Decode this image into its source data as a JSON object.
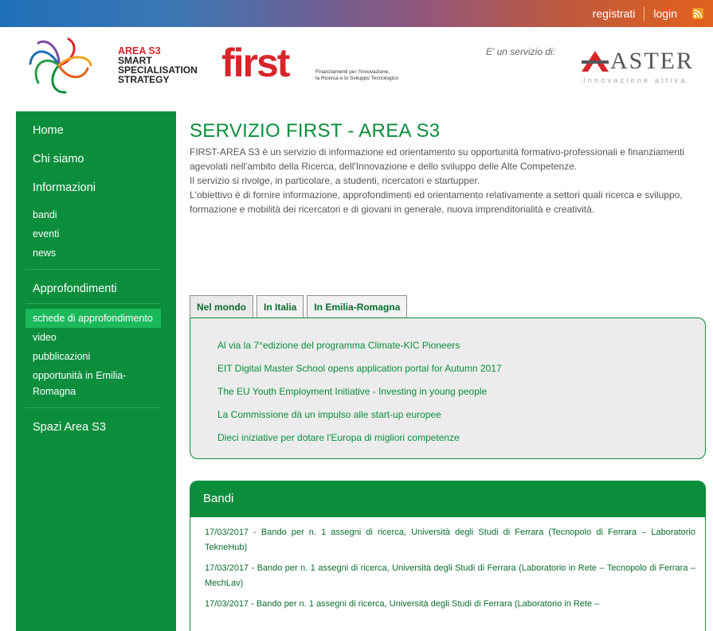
{
  "topbar": {
    "register": "registrati",
    "login": "login",
    "rss_icon": "rss-icon"
  },
  "header": {
    "area_logo": {
      "line1": "AREA S3",
      "line2": "SMART",
      "line3": "SPECIALISATION",
      "line4": "STRATEGY"
    },
    "first_logo": {
      "word": "first",
      "sub1": "Finanziamenti per l'Innovazione,",
      "sub2": "la Ricerca e lo Sviluppo Tecnologico"
    },
    "service_label": "E' un servizio di:",
    "aster_logo": {
      "word": "ASTER",
      "sub": "Innovazione attiva"
    }
  },
  "sidebar": {
    "items": [
      {
        "label": "Home"
      },
      {
        "label": "Chi siamo"
      },
      {
        "label": "Informazioni"
      }
    ],
    "info_sub": [
      "bandi",
      "eventi",
      "news"
    ],
    "approfondimenti": "Approfondimenti",
    "appro_sub": [
      {
        "label": "schede di approfondimento",
        "active": true
      },
      {
        "label": "video"
      },
      {
        "label": "pubblicazioni"
      },
      {
        "label": "opportunità in Emilia-Romagna"
      }
    ],
    "spazi": "Spazi Area S3"
  },
  "main": {
    "title": "SERVIZIO FIRST - AREA S3",
    "p1": "FIRST-AREA S3 è un servizio di informazione ed orientamento su opportunità formativo-professionali e finanziamenti agevolati nell'ambito della Ricerca, dell'Innovazione e dello sviluppo delle Alte Competenze.",
    "p2": "Il servizio si rivolge, in particolare, a studenti, ricercatori e startupper.",
    "p3": "L'obiettivo è di fornire informazione, approfondimenti ed orientamento relativamente a settori quali ricerca e sviluppo, formazione e mobilità dei ricercatori e di giovani in generale, nuova imprenditorialità e creatività."
  },
  "tabs": {
    "labels": [
      "Nel mondo",
      "In Italia",
      "In Emilia-Romagna"
    ],
    "active": 0,
    "news": [
      "Al via la 7°edizione del programma Climate-KIC Pioneers",
      "EIT Digital Master School opens application portal for Autumn 2017",
      "The EU Youth Employment Initiative - Investing in young people",
      "La Commissione dà un impulso alle start-up europee",
      "Dieci iniziative per dotare l'Europa di migliori competenze"
    ]
  },
  "bandi": {
    "title": "Bandi",
    "items": [
      "17/03/2017 - Bando per n. 1 assegni di ricerca, Università degli Studi di Ferrara (Tecnopolo di Ferrara – Laboratorio TekneHub)",
      "17/03/2017 - Bando per n. 1 assegni di ricerca, Università degli Studi di Ferrara (Laboratorio in Rete – Tecnopolo di Ferrara – MechLav)",
      "17/03/2017 - Bando per n. 1 assegni di ricerca, Università degli Studi di Ferrara (Laboratorio in Rete –"
    ]
  },
  "colors": {
    "green": "#0b8e3c",
    "green_active": "#1bb85a",
    "red_logo": "#d7262b"
  }
}
